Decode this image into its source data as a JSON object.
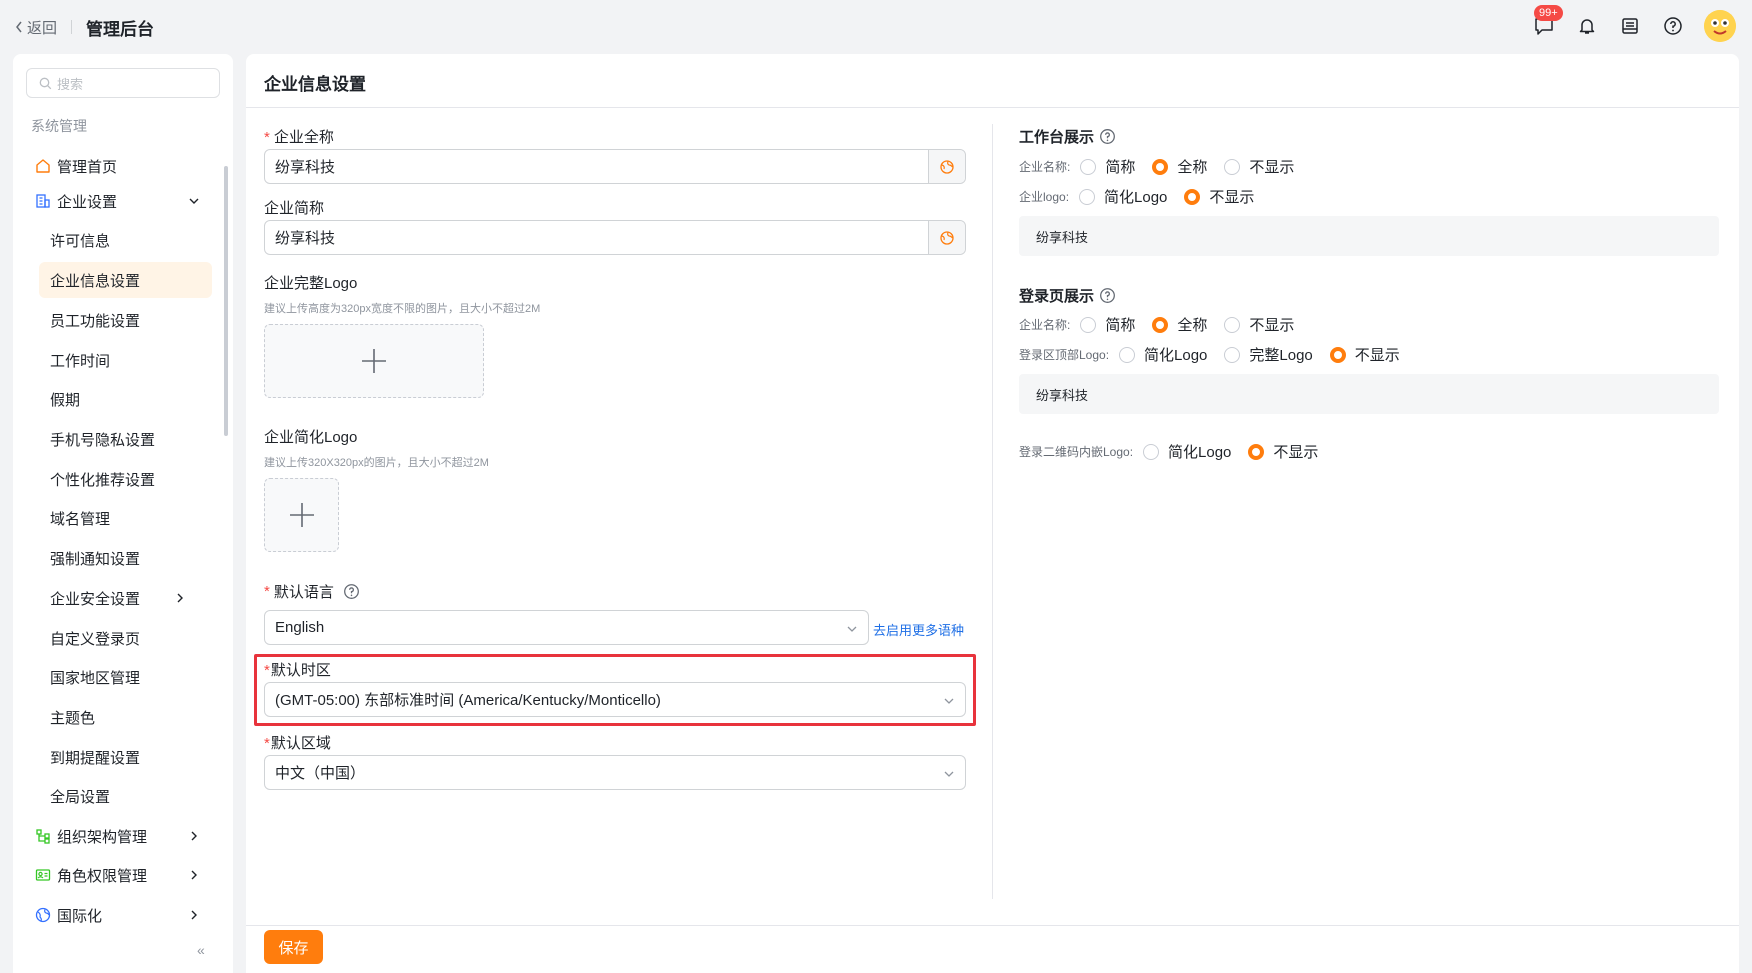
{
  "header": {
    "back_label": "返回",
    "title": "管理后台",
    "badge": "99+",
    "icons": [
      "chat-icon",
      "bell-icon",
      "inbox-icon",
      "help-icon",
      "avatar"
    ]
  },
  "sidebar": {
    "search_placeholder": "搜索",
    "group_label": "系统管理",
    "items": [
      {
        "label": "管理首页",
        "icon": "home-icon"
      },
      {
        "label": "企业设置",
        "icon": "building-icon",
        "expanded": true
      },
      {
        "label": "许可信息"
      },
      {
        "label": "企业信息设置",
        "active": true
      },
      {
        "label": "员工功能设置"
      },
      {
        "label": "工作时间"
      },
      {
        "label": "假期"
      },
      {
        "label": "手机号隐私设置"
      },
      {
        "label": "个性化推荐设置"
      },
      {
        "label": "域名管理"
      },
      {
        "label": "强制通知设置"
      },
      {
        "label": "企业安全设置",
        "has_children": true
      },
      {
        "label": "自定义登录页"
      },
      {
        "label": "国家地区管理"
      },
      {
        "label": "主题色"
      },
      {
        "label": "到期提醒设置"
      },
      {
        "label": "全局设置"
      },
      {
        "label": "组织架构管理",
        "icon": "org-icon",
        "has_children": true
      },
      {
        "label": "角色权限管理",
        "icon": "role-icon",
        "has_children": true
      },
      {
        "label": "国际化",
        "icon": "globe-icon",
        "has_children": true
      }
    ],
    "collapse_glyph": "«"
  },
  "main": {
    "title": "企业信息设置",
    "full_name": {
      "label": "企业全称",
      "required": "*",
      "value": "纷享科技"
    },
    "short_name": {
      "label": "企业简称",
      "value": "纷享科技"
    },
    "full_logo": {
      "label": "企业完整Logo",
      "hint": "建议上传高度为320px宽度不限的图片，且大小不超过2M"
    },
    "short_logo": {
      "label": "企业简化Logo",
      "hint": "建议上传320X320px的图片，且大小不超过2M"
    },
    "language": {
      "label": "默认语言",
      "required": "*",
      "value": "English",
      "link": "去启用更多语种"
    },
    "timezone": {
      "label": "默认时区",
      "required": "*",
      "value": "(GMT-05:00) 东部标准时间 (America/Kentucky/Monticello)"
    },
    "region": {
      "label": "默认区域",
      "required": "*",
      "value": "中文（中国）"
    },
    "save_label": "保存"
  },
  "workbench": {
    "title": "工作台展示",
    "name_row": {
      "label": "企业名称:",
      "options": [
        "简称",
        "全称",
        "不显示"
      ],
      "selected": "全称"
    },
    "logo_row": {
      "label": "企业logo:",
      "options": [
        "简化Logo",
        "不显示"
      ],
      "selected": "不显示"
    },
    "preview": "纷享科技"
  },
  "login_page": {
    "title": "登录页展示",
    "name_row": {
      "label": "企业名称:",
      "options": [
        "简称",
        "全称",
        "不显示"
      ],
      "selected": "全称"
    },
    "top_logo_row": {
      "label": "登录区顶部Logo:",
      "options": [
        "简化Logo",
        "完整Logo",
        "不显示"
      ],
      "selected": "不显示"
    },
    "preview": "纷享科技",
    "qr_logo_row": {
      "label": "登录二维码内嵌Logo:",
      "options": [
        "简化Logo",
        "不显示"
      ],
      "selected": "不显示"
    }
  },
  "colors": {
    "accent": "#ff7d0d",
    "highlight": "#e8333c",
    "link": "#1f6fe6"
  }
}
